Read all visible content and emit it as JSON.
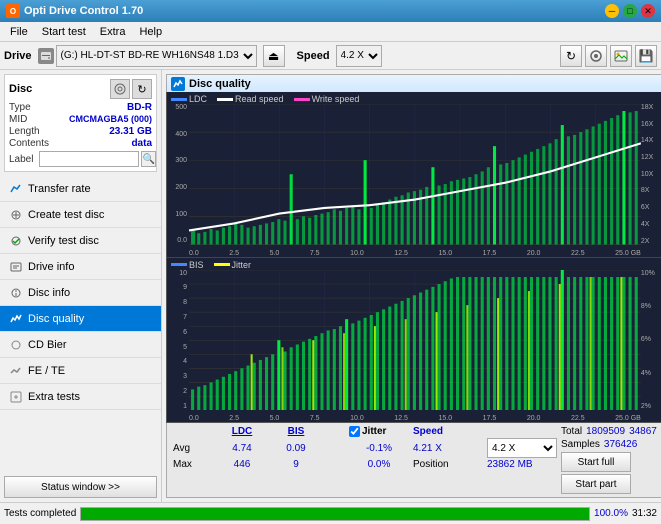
{
  "titlebar": {
    "title": "Opti Drive Control 1.70",
    "icon": "O"
  },
  "menubar": {
    "items": [
      "File",
      "Start test",
      "Extra",
      "Help"
    ]
  },
  "drivebar": {
    "label": "Drive",
    "drive_value": "(G:) HL-DT-ST BD-RE  WH16NS48 1.D3",
    "speed_label": "Speed",
    "speed_value": "4.2 X"
  },
  "sidebar": {
    "disc": {
      "title": "Disc",
      "type_label": "Type",
      "type_value": "BD-R",
      "mid_label": "MID",
      "mid_value": "CMCMAGBA5 (000)",
      "length_label": "Length",
      "length_value": "23.31 GB",
      "contents_label": "Contents",
      "contents_value": "data",
      "label_label": "Label"
    },
    "nav_items": [
      {
        "id": "transfer-rate",
        "label": "Transfer rate",
        "active": false
      },
      {
        "id": "create-test-disc",
        "label": "Create test disc",
        "active": false
      },
      {
        "id": "verify-test-disc",
        "label": "Verify test disc",
        "active": false
      },
      {
        "id": "drive-info",
        "label": "Drive info",
        "active": false
      },
      {
        "id": "disc-info",
        "label": "Disc info",
        "active": false
      },
      {
        "id": "disc-quality",
        "label": "Disc quality",
        "active": true
      },
      {
        "id": "cd-bier",
        "label": "CD Bier",
        "active": false
      },
      {
        "id": "fe-te",
        "label": "FE / TE",
        "active": false
      },
      {
        "id": "extra-tests",
        "label": "Extra tests",
        "active": false
      }
    ],
    "status_btn": "Status window >>"
  },
  "content": {
    "title": "Disc quality",
    "legend_top": [
      "LDC",
      "Read speed",
      "Write speed"
    ],
    "legend_bottom": [
      "BIS",
      "Jitter"
    ],
    "chart_top": {
      "y_left": [
        "500",
        "400",
        "300",
        "200",
        "100",
        "0.0"
      ],
      "y_right": [
        "18X",
        "16X",
        "14X",
        "12X",
        "10X",
        "8X",
        "6X",
        "4X",
        "2X"
      ],
      "x_labels": [
        "0.0",
        "2.5",
        "5.0",
        "7.5",
        "10.0",
        "12.5",
        "15.0",
        "17.5",
        "20.0",
        "22.5",
        "25.0 GB"
      ]
    },
    "chart_bottom": {
      "y_left": [
        "10",
        "9",
        "8",
        "7",
        "6",
        "5",
        "4",
        "3",
        "2",
        "1"
      ],
      "y_right": [
        "10%",
        "8%",
        "6%",
        "4%",
        "2%"
      ],
      "x_labels": [
        "0.0",
        "2.5",
        "5.0",
        "7.5",
        "10.0",
        "12.5",
        "15.0",
        "17.5",
        "20.0",
        "22.5",
        "25.0 GB"
      ]
    }
  },
  "stats": {
    "headers": [
      "LDC",
      "BIS",
      "",
      "Jitter",
      "Speed",
      ""
    ],
    "avg_label": "Avg",
    "avg_ldc": "4.74",
    "avg_bis": "0.09",
    "avg_jitter": "-0.1%",
    "avg_speed_label": "Speed",
    "avg_speed_value": "4.21 X",
    "max_label": "Max",
    "max_ldc": "446",
    "max_bis": "9",
    "max_jitter": "0.0%",
    "position_label": "Position",
    "position_value": "23862 MB",
    "total_label": "Total",
    "total_ldc": "1809509",
    "total_bis": "34867",
    "samples_label": "Samples",
    "samples_value": "376426",
    "jitter_checked": true,
    "speed_dropdown": "4.2 X",
    "btn_start_full": "Start full",
    "btn_start_part": "Start part"
  },
  "statusbar": {
    "text": "Tests completed",
    "progress": 100,
    "time": "31:32"
  }
}
